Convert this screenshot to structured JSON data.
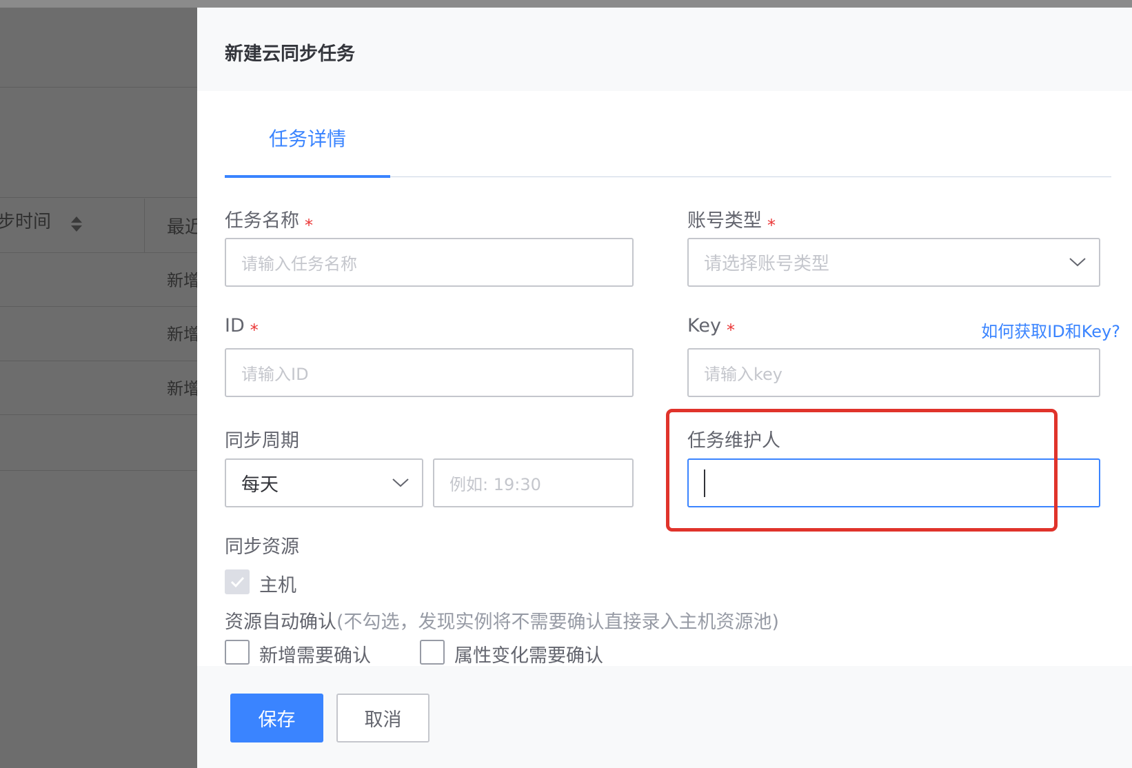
{
  "background": {
    "table_header": [
      "同步时间",
      "最近"
    ],
    "rows": [
      "新增",
      "新增",
      "新增"
    ]
  },
  "drawer": {
    "title": "新建云同步任务",
    "tab": "任务详情",
    "form": {
      "task_name": {
        "label": "任务名称",
        "required": "*",
        "placeholder": "请输入任务名称"
      },
      "account_type": {
        "label": "账号类型",
        "required": "*",
        "placeholder": "请选择账号类型"
      },
      "id": {
        "label": "ID",
        "required": "*",
        "placeholder": "请输入ID"
      },
      "key": {
        "label": "Key",
        "required": "*",
        "placeholder": "请输入key",
        "help_link": "如何获取ID和Key?"
      },
      "sync_period": {
        "label": "同步周期",
        "value": "每天",
        "time_placeholder": "例如: 19:30"
      },
      "maintainer": {
        "label": "任务维护人",
        "value": ""
      },
      "sync_resources": {
        "label": "同步资源",
        "options": [
          {
            "label": "主机",
            "checked": true,
            "disabled": true
          }
        ]
      },
      "auto_confirm": {
        "label": "资源自动确认",
        "hint": "(不勾选，发现实例将不需要确认直接录入主机资源池)",
        "options": [
          {
            "label": "新增需要确认",
            "checked": false
          },
          {
            "label": "属性变化需要确认",
            "checked": false
          }
        ]
      }
    },
    "buttons": {
      "save": "保存",
      "cancel": "取消"
    }
  },
  "colors": {
    "accent": "#3a84ff",
    "required": "#ea3636",
    "highlight": "#e0332b"
  },
  "icons": [
    "sort-icon",
    "chevron-down-icon",
    "check-icon"
  ]
}
